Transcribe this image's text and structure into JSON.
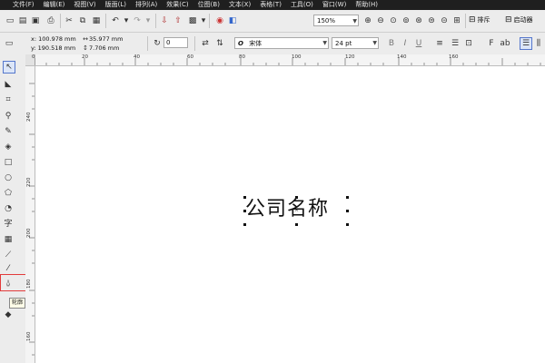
{
  "menu": [
    "文件(F)",
    "编辑(E)",
    "视图(V)",
    "版面(L)",
    "排列(A)",
    "效果(C)",
    "位图(B)",
    "文本(X)",
    "表格(T)",
    "工具(O)",
    "窗口(W)",
    "帮助(H)"
  ],
  "toolbar": {
    "zoom_value": "150%",
    "snap_label": "排斥",
    "launch_label": "启动器"
  },
  "property_bar": {
    "x": "x: 100.978 mm",
    "y": "y: 190.518 mm",
    "w": "35.977 mm",
    "h": "7.706 mm",
    "rotation": "0",
    "font_name": "宋体",
    "font_size": "24 pt"
  },
  "ruler_top": [
    "0",
    "20",
    "40",
    "60",
    "80",
    "100",
    "120",
    "140",
    "160"
  ],
  "ruler_left": [
    "240",
    "220",
    "200",
    "180",
    "160"
  ],
  "tool_tip": "轮廓",
  "canvas_text": "公司名称",
  "tools": [
    "pick-tool",
    "shape-tool",
    "crop-tool",
    "zoom-tool",
    "freehand-tool",
    "smart-fill-tool",
    "rectangle-tool",
    "ellipse-tool",
    "polygon-tool",
    "basic-shapes-tool",
    "text-tool",
    "table-tool",
    "dimension-tool",
    "connector-tool",
    "blend-tool",
    "eyedropper-tool",
    "outline-tool",
    "fill-tool"
  ],
  "colors": {
    "menubar_bg": "#1f1f1f",
    "toolbar_bg": "#ececec",
    "highlight": "#e23b3b"
  }
}
